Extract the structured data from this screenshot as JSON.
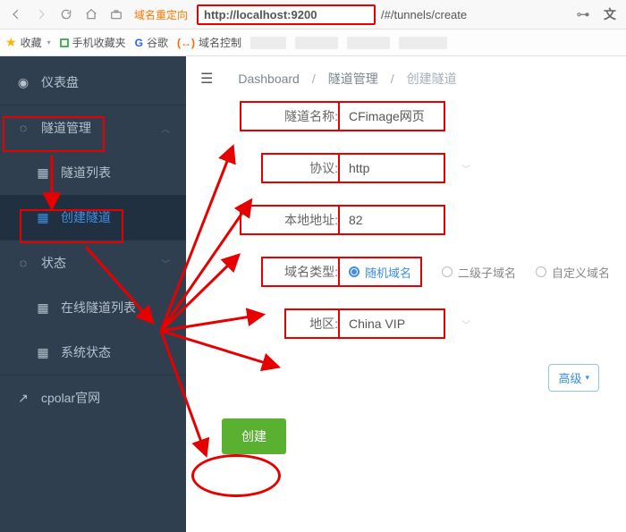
{
  "browser": {
    "redirect_label": "域名重定向",
    "url_highlight": "http://localhost:9200",
    "url_tail": "/#/tunnels/create",
    "bookmarks": {
      "fav": "收藏",
      "mobile": "手机收藏夹",
      "google": "谷歌",
      "domain_ctrl": "域名控制"
    }
  },
  "sidebar": {
    "dashboard": "仪表盘",
    "tunnel_mgmt": "隧道管理",
    "tunnel_list": "隧道列表",
    "create_tunnel": "创建隧道",
    "status": "状态",
    "online_tunnels": "在线隧道列表",
    "system_status": "系统状态",
    "official": "cpolar官网"
  },
  "breadcrumbs": {
    "a": "Dashboard",
    "b": "隧道管理",
    "c": "创建隧道"
  },
  "form": {
    "name_label": "隧道名称:",
    "name_value": "CFimage网页",
    "proto_label": "协议:",
    "proto_value": "http",
    "local_label": "本地地址:",
    "local_value": "82",
    "domain_type_label": "域名类型:",
    "domain_opts": {
      "random": "随机域名",
      "sub": "二级子域名",
      "custom": "自定义域名"
    },
    "region_label": "地区:",
    "region_value": "China VIP",
    "advanced": "高级",
    "create": "创建"
  }
}
